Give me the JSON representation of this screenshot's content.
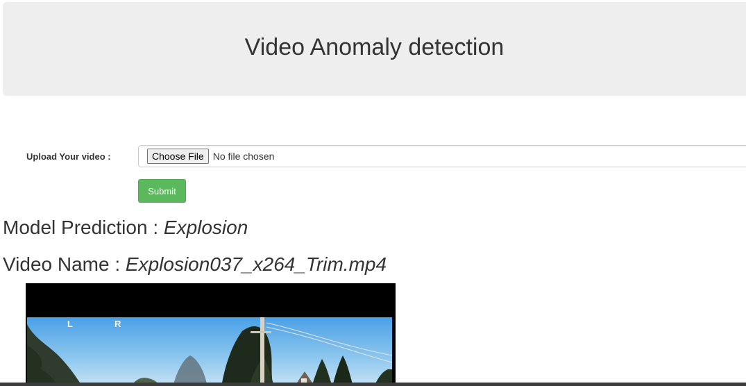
{
  "header": {
    "title": "Video Anomaly detection"
  },
  "upload_form": {
    "label": "Upload Your video :",
    "choose_button": "Choose File",
    "file_status": "No file chosen",
    "submit_label": "Submit"
  },
  "results": {
    "prediction_label": "Model Prediction : ",
    "prediction_value": "Explosion",
    "video_name_label": "Video Name : ",
    "video_name_value": "Explosion037_x264_Trim.mp4"
  },
  "video_overlay": {
    "left_marker": "L",
    "right_marker": "R"
  },
  "colors": {
    "header_bg": "#eeeeee",
    "submit_bg": "#5cb85c",
    "text": "#333333",
    "video_bg": "#000000"
  }
}
